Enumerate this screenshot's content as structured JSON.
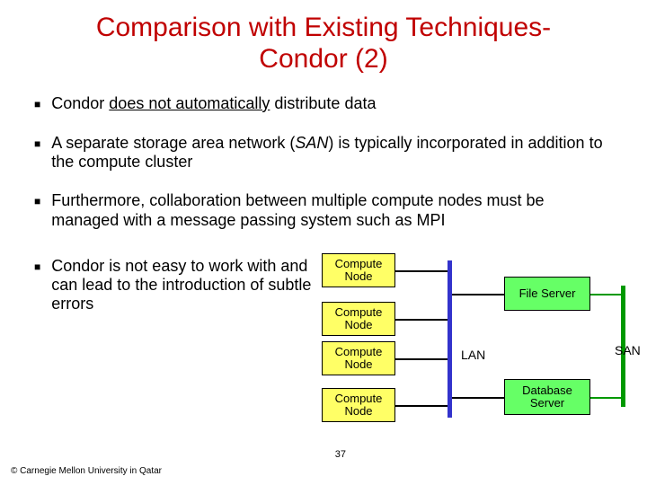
{
  "title": "Comparison with Existing Techniques-\nCondor (2)",
  "bullets": {
    "b1_pre": "Condor ",
    "b1_und": "does not automatically",
    "b1_post": " distribute data",
    "b2_pre": "A separate storage area network (",
    "b2_ital": "SAN",
    "b2_post": ") is typically incorporated in addition to the compute cluster",
    "b3": "Furthermore, collaboration between multiple compute nodes must be managed with a message passing system such as MPI",
    "b4": "Condor is not easy to work with and can lead to the introduction of subtle errors"
  },
  "diagram": {
    "compute_node": "Compute\nNode",
    "file_server": "File Server",
    "database_server": "Database\nServer",
    "lan": "LAN",
    "san": "SAN"
  },
  "page_number": "37",
  "copyright": "© Carnegie Mellon University in Qatar"
}
